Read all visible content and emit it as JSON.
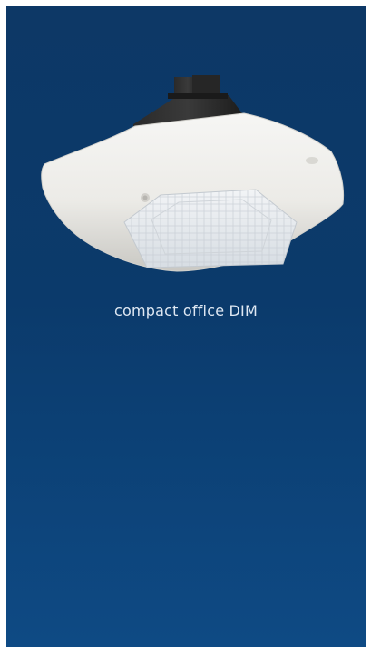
{
  "product": {
    "caption": "compact office DIM",
    "image_icon": "ceiling-presence-detector-image",
    "colors": {
      "panel_top": "#0d3866",
      "panel_bottom": "#0e4a84",
      "caption_text": "#dfe8f3",
      "page_background": "#ffffff"
    }
  }
}
